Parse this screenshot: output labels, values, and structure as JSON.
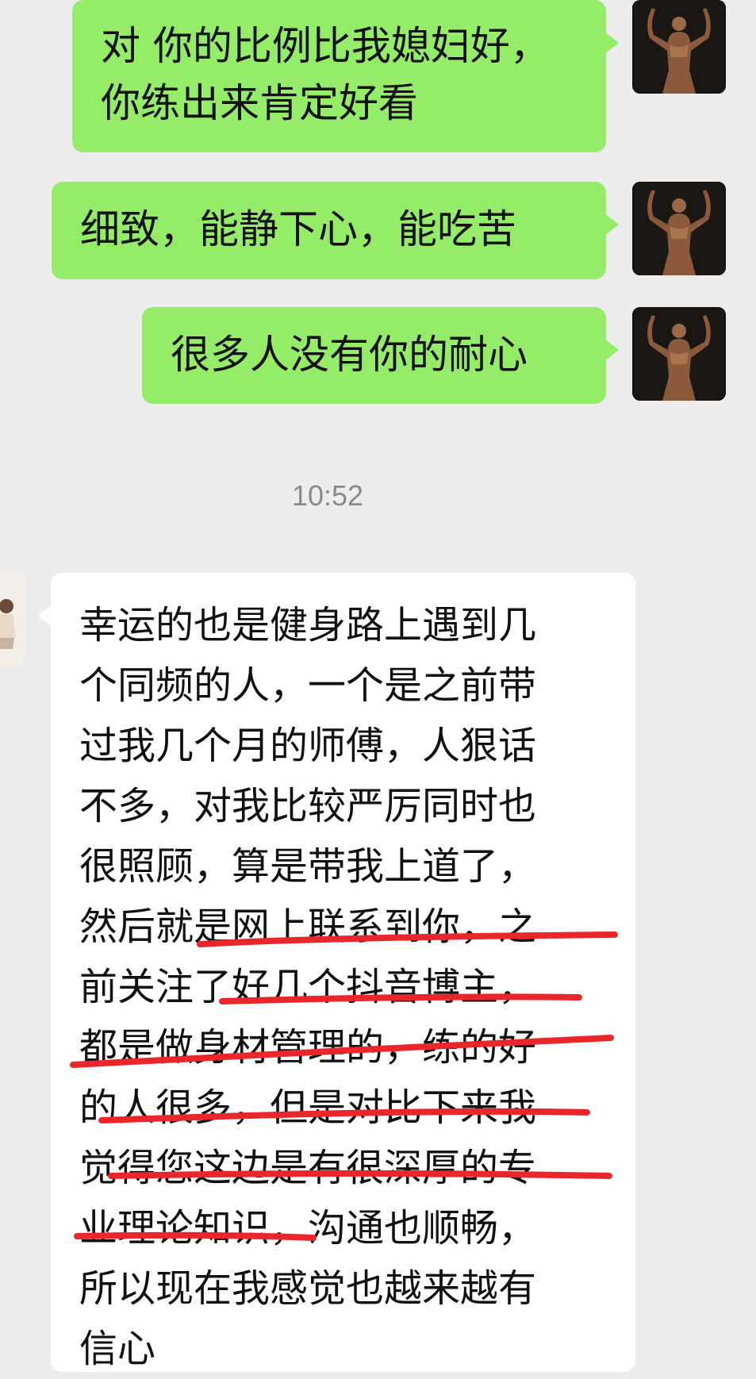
{
  "messages": [
    {
      "direction": "out",
      "text": "对 你的比例比我媳妇好，\n你练出来肯定好看"
    },
    {
      "direction": "out",
      "text": "细致，能静下心，能吃苦"
    },
    {
      "direction": "out",
      "text": "很多人没有你的耐心"
    },
    {
      "direction": "in",
      "text": "幸运的也是健身路上遇到几\n个同频的人，一个是之前带\n过我几个月的师傅，人狠话\n不多，对我比较严厉同时也\n很照顾，算是带我上道了，\n然后就是网上联系到你，之\n前关注了好几个抖音博主，\n都是做身材管理的，练的好\n的人很多，但是对比下来我\n觉得您这边是有很深厚的专\n业理论知识，沟通也顺畅，\n所以现在我感觉也越来越有\n信心"
    }
  ],
  "timestamp": "10:52",
  "annotation": {
    "color": "#e8262c",
    "style": "hand-drawn-underline"
  },
  "avatars": {
    "self": "bodybuilder-avatar",
    "other": "girl-avatar"
  }
}
